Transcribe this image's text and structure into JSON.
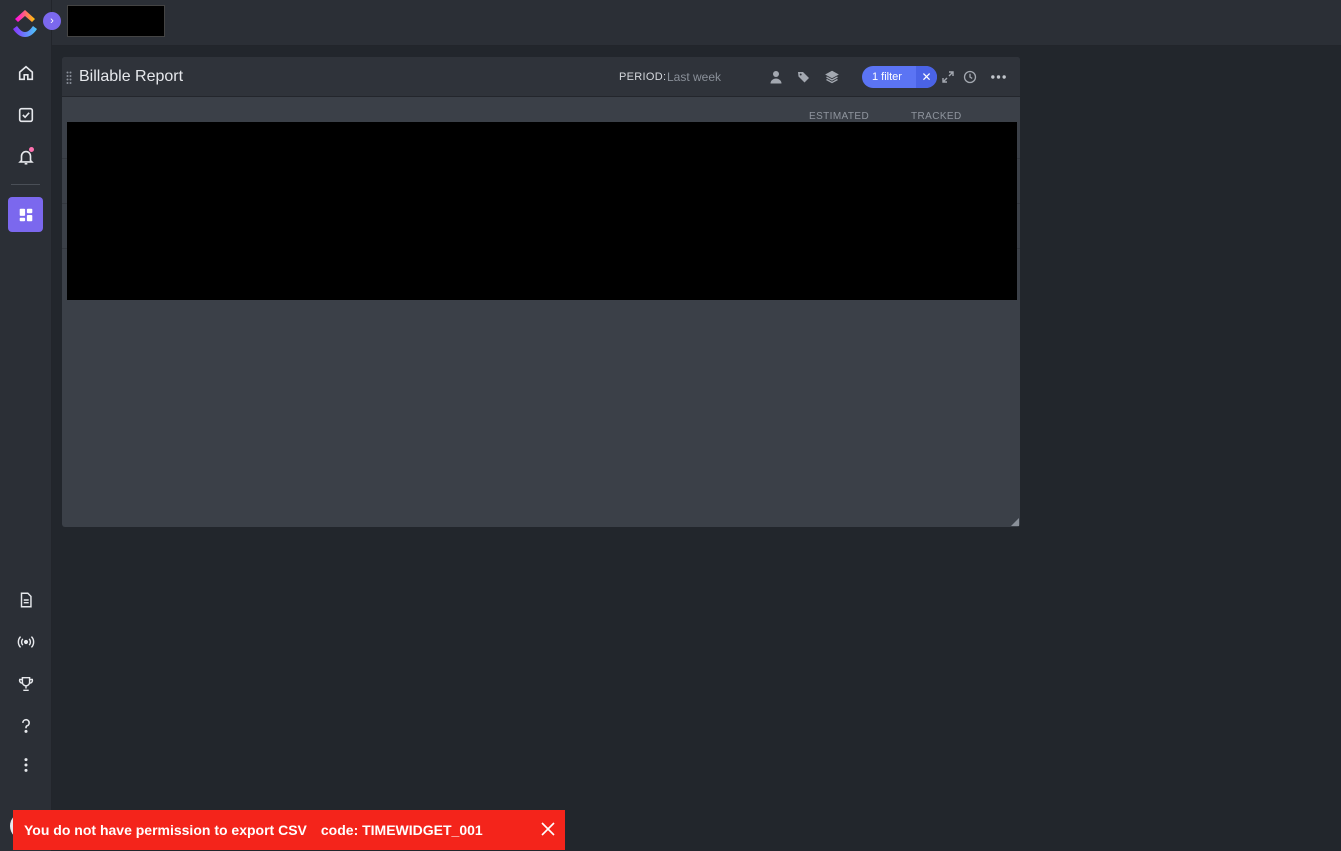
{
  "sidebar": {
    "expand_glyph": "›",
    "top_items": [
      {
        "name": "home-icon"
      },
      {
        "name": "my-work-icon"
      },
      {
        "name": "notifications-icon"
      },
      {
        "name": "dashboards-icon",
        "active": true
      }
    ],
    "bottom_items": [
      {
        "name": "docs-icon"
      },
      {
        "name": "pulse-icon"
      },
      {
        "name": "goals-icon"
      },
      {
        "name": "help-icon"
      },
      {
        "name": "more-icon"
      }
    ]
  },
  "widget": {
    "title": "Billable Report",
    "period_label": "PERIOD:",
    "period_value": "Last week",
    "filter_label": "1 filter",
    "filter_clear": "✕",
    "columns": [
      "ESTIMATED",
      "TRACKED"
    ]
  },
  "toast": {
    "message": "You do not have permission to export CSV",
    "code": "code: TIMEWIDGET_001"
  },
  "colors": {
    "accent": "#7b68ee",
    "filter": "#5b74f4",
    "error": "#f4241b"
  }
}
